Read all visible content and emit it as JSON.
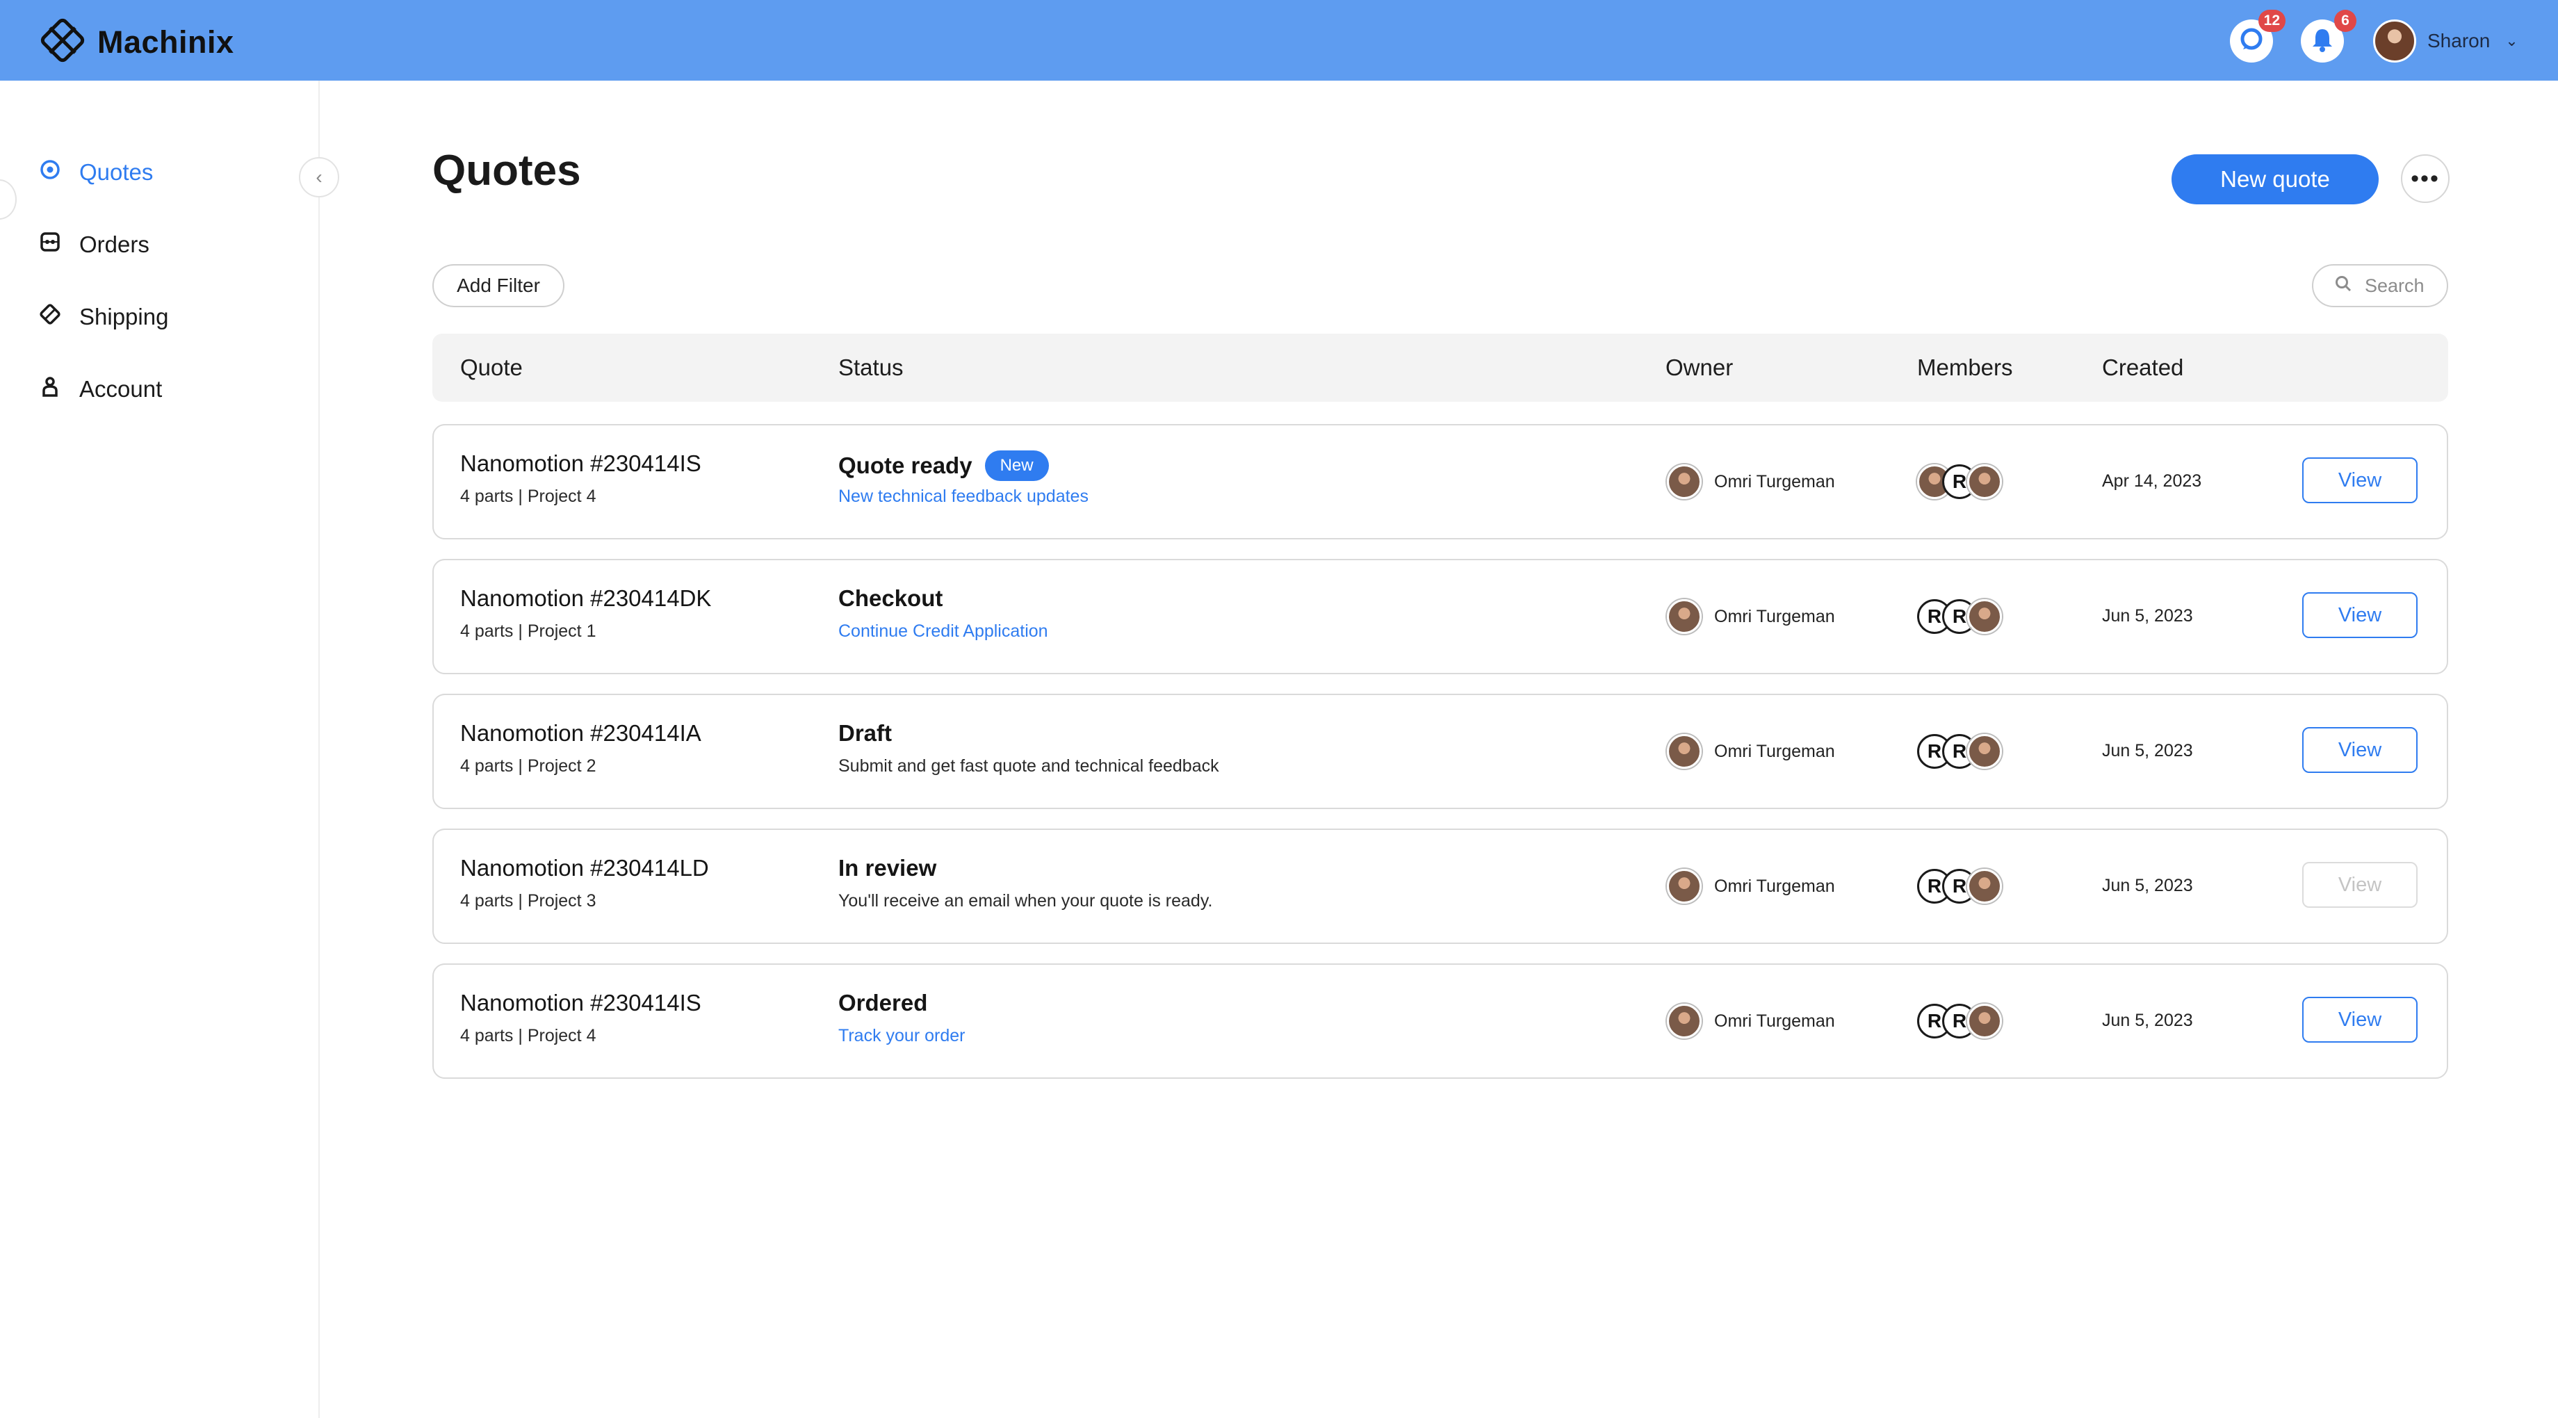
{
  "app": {
    "name": "Machinix"
  },
  "header": {
    "messages_badge": "12",
    "notifications_badge": "6",
    "user_name": "Sharon"
  },
  "sidebar": {
    "items": [
      {
        "label": "Quotes",
        "icon": "target-icon",
        "active": true
      },
      {
        "label": "Orders",
        "icon": "orders-icon",
        "active": false
      },
      {
        "label": "Shipping",
        "icon": "shipping-icon",
        "active": false
      },
      {
        "label": "Account",
        "icon": "person-icon",
        "active": false
      }
    ]
  },
  "page": {
    "title": "Quotes",
    "new_quote_label": "New quote",
    "add_filter_label": "Add Filter",
    "search_placeholder": "Search"
  },
  "table": {
    "columns": [
      "Quote",
      "Status",
      "Owner",
      "Members",
      "Created"
    ],
    "rows": [
      {
        "name": "Nanomotion #230414IS",
        "sub": "4 parts | Project 4",
        "status": "Quote ready",
        "badge": "New",
        "status_sub": "New technical feedback updates",
        "status_sub_link": true,
        "owner": "Omri Turgeman",
        "members": [
          "photo",
          "R",
          "photo"
        ],
        "created": "Apr 14, 2023",
        "action": "View",
        "action_enabled": true
      },
      {
        "name": "Nanomotion #230414DK",
        "sub": "4 parts | Project 1",
        "status": "Checkout",
        "badge": "",
        "status_sub": "Continue Credit Application",
        "status_sub_link": true,
        "owner": "Omri Turgeman",
        "members": [
          "R",
          "R",
          "photo"
        ],
        "created": "Jun 5, 2023",
        "action": "View",
        "action_enabled": true
      },
      {
        "name": "Nanomotion #230414IA",
        "sub": "4 parts | Project 2",
        "status": "Draft",
        "badge": "",
        "status_sub": "Submit and get fast quote and technical feedback",
        "status_sub_link": false,
        "owner": "Omri Turgeman",
        "members": [
          "R",
          "R",
          "photo"
        ],
        "created": "Jun 5, 2023",
        "action": "View",
        "action_enabled": true
      },
      {
        "name": "Nanomotion #230414LD",
        "sub": "4 parts | Project 3",
        "status": "In review",
        "badge": "",
        "status_sub": "You'll receive an email when your quote is ready.",
        "status_sub_link": false,
        "owner": "Omri Turgeman",
        "members": [
          "R",
          "R",
          "photo"
        ],
        "created": "Jun 5, 2023",
        "action": "View",
        "action_enabled": false
      },
      {
        "name": "Nanomotion #230414IS",
        "sub": "4 parts | Project 4",
        "status": "Ordered",
        "badge": "",
        "status_sub": "Track your order",
        "status_sub_link": true,
        "owner": "Omri Turgeman",
        "members": [
          "R",
          "R",
          "photo"
        ],
        "created": "Jun 5, 2023",
        "action": "View",
        "action_enabled": true
      }
    ]
  },
  "colors": {
    "header_bg": "#5e9cf0",
    "accent": "#2f7cf0",
    "badge_red": "#e04848"
  }
}
